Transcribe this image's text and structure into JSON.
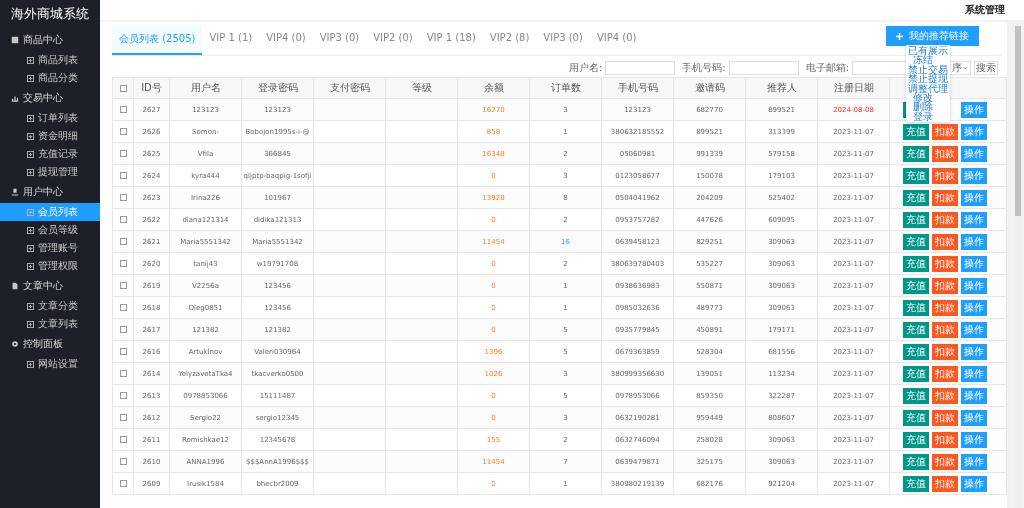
{
  "sidebar": {
    "title": "海外商城系统",
    "groups": [
      {
        "label": "商品中心",
        "children": [
          {
            "label": "商品列表",
            "selected": false
          },
          {
            "label": "商品分类",
            "selected": false
          }
        ]
      },
      {
        "label": "交易中心",
        "children": [
          {
            "label": "订单列表",
            "selected": false
          },
          {
            "label": "资金明细",
            "selected": false
          },
          {
            "label": "充值记录",
            "selected": false
          },
          {
            "label": "提现管理",
            "selected": false
          }
        ]
      },
      {
        "label": "用户中心",
        "children": [
          {
            "label": "会员列表",
            "selected": true
          },
          {
            "label": "会员等级",
            "selected": false
          },
          {
            "label": "管理账号",
            "selected": false
          },
          {
            "label": "管理权限",
            "selected": false
          }
        ]
      },
      {
        "label": "文章中心",
        "children": [
          {
            "label": "文章分类",
            "selected": false
          },
          {
            "label": "文章列表",
            "selected": false
          }
        ]
      },
      {
        "label": "控制面板",
        "children": [
          {
            "label": "网站设置",
            "selected": false
          }
        ]
      }
    ]
  },
  "header": {
    "title": "系统管理"
  },
  "tabs": [
    {
      "label": "会员列表 (2505)",
      "selected": true
    },
    {
      "label": "VIP 1 (1)",
      "selected": false
    },
    {
      "label": "VIP4 (0)",
      "selected": false
    },
    {
      "label": "VIP3 (0)",
      "selected": false
    },
    {
      "label": "VIP2 (0)",
      "selected": false
    },
    {
      "label": "VIP 1 (18)",
      "selected": false
    },
    {
      "label": "VIP2 (8)",
      "selected": false
    },
    {
      "label": "VIP3 (0)",
      "selected": false
    },
    {
      "label": "VIP4 (0)",
      "selected": false
    }
  ],
  "link_button": "我的推荐链接",
  "filters": {
    "fields": [
      {
        "label": "用户名:"
      },
      {
        "label": "手机号码:"
      },
      {
        "label": "电子邮箱:"
      }
    ],
    "select": "序",
    "search_button": "搜索"
  },
  "menu": [
    {
      "label": "已有展示",
      "children": [
        {
          "label": "冻结"
        }
      ]
    },
    {
      "label": "禁止交易"
    },
    {
      "label": "禁止提现"
    },
    {
      "label": "调整代理",
      "children": [
        {
          "label": "修改"
        },
        {
          "label": "删除"
        },
        {
          "label": "登录"
        }
      ]
    }
  ],
  "table": {
    "select_all_checked": false,
    "columns": [
      "ID号",
      "用户名",
      "登录密码",
      "支付密码",
      "等级",
      "余额",
      "订单数",
      "手机号码",
      "邀请码",
      "推荐人",
      "注册日期"
    ],
    "rows": [
      {
        "checked": false,
        "id": "2627",
        "user": "123123",
        "password": "123123",
        "balance": "16270",
        "orders": "3",
        "orders_linked": false,
        "phone": "123123",
        "invite": "682770",
        "referrer": "899521",
        "date": "2024-08-08",
        "date_alert": true,
        "actions": [
          {
            "kind": "recharge"
          },
          {
            "kind": "edit",
            "label": "操作"
          }
        ]
      },
      {
        "checked": false,
        "id": "2626",
        "user": "Somon-",
        "password": "Bobojon1995s-i-@",
        "balance": "858",
        "orders": "1",
        "orders_linked": false,
        "phone": "380632185552",
        "invite": "899521",
        "referrer": "313399",
        "date": "2023-11-07",
        "date_alert": false,
        "actions": [
          {
            "kind": "recharge",
            "label": "充值"
          },
          {
            "kind": "deduct",
            "label": "扣款"
          },
          {
            "kind": "edit",
            "label": "操作"
          }
        ]
      },
      {
        "checked": false,
        "id": "2625",
        "user": "Vfila",
        "password": "366845",
        "balance": "16348",
        "orders": "2",
        "orders_linked": false,
        "phone": "05060981",
        "invite": "991339",
        "referrer": "579158",
        "date": "2023-11-07",
        "date_alert": false,
        "actions": [
          {
            "kind": "recharge",
            "label": "充值"
          },
          {
            "kind": "deduct",
            "label": "扣款"
          },
          {
            "kind": "edit",
            "label": "操作"
          }
        ]
      },
      {
        "checked": false,
        "id": "2624",
        "user": "kyra444",
        "password": "qljptp-baqpig-1sofji",
        "balance": "0",
        "orders": "3",
        "orders_linked": false,
        "phone": "0123058677",
        "invite": "150078",
        "referrer": "179103",
        "date": "2023-11-07",
        "date_alert": false,
        "actions": [
          {
            "kind": "recharge",
            "label": "充值"
          },
          {
            "kind": "deduct",
            "label": "扣款"
          },
          {
            "kind": "edit",
            "label": "操作"
          }
        ]
      },
      {
        "checked": false,
        "id": "2623",
        "user": "Irina226",
        "password": "101967",
        "balance": "13920",
        "orders": "8",
        "orders_linked": false,
        "phone": "0504041962",
        "invite": "204209",
        "referrer": "525402",
        "date": "2023-11-07",
        "date_alert": false,
        "actions": [
          {
            "kind": "recharge",
            "label": "充值"
          },
          {
            "kind": "deduct",
            "label": "扣款"
          },
          {
            "kind": "edit",
            "label": "操作"
          }
        ]
      },
      {
        "checked": false,
        "id": "2622",
        "user": "diana121314",
        "password": "didika121313",
        "balance": "0",
        "orders": "2",
        "orders_linked": false,
        "phone": "0953757282",
        "invite": "447626",
        "referrer": "609095",
        "date": "2023-11-07",
        "date_alert": false,
        "actions": [
          {
            "kind": "recharge",
            "label": "充值"
          },
          {
            "kind": "deduct",
            "label": "扣款"
          },
          {
            "kind": "edit",
            "label": "操作"
          }
        ]
      },
      {
        "checked": false,
        "id": "2621",
        "user": "Maria5551342",
        "password": "Maria5551342",
        "balance": "11454",
        "orders": "16",
        "orders_linked": true,
        "phone": "0639458123",
        "invite": "829251",
        "referrer": "309063",
        "date": "2023-11-07",
        "date_alert": false,
        "actions": [
          {
            "kind": "recharge",
            "label": "充值"
          },
          {
            "kind": "deduct",
            "label": "扣款"
          },
          {
            "kind": "edit",
            "label": "操作"
          }
        ]
      },
      {
        "checked": false,
        "id": "2620",
        "user": "tanij43",
        "password": "w19791708",
        "balance": "0",
        "orders": "2",
        "orders_linked": false,
        "phone": "380639780403",
        "invite": "535227",
        "referrer": "309063",
        "date": "2023-11-07",
        "date_alert": false,
        "actions": [
          {
            "kind": "recharge",
            "label": "充值"
          },
          {
            "kind": "deduct",
            "label": "扣款"
          },
          {
            "kind": "edit",
            "label": "操作"
          }
        ]
      },
      {
        "checked": false,
        "id": "2619",
        "user": "V2256a",
        "password": "123456",
        "balance": "0",
        "orders": "1",
        "orders_linked": false,
        "phone": "0938636983",
        "invite": "550871",
        "referrer": "309063",
        "date": "2023-11-07",
        "date_alert": false,
        "actions": [
          {
            "kind": "recharge",
            "label": "充值"
          },
          {
            "kind": "deduct",
            "label": "扣款"
          },
          {
            "kind": "edit",
            "label": "操作"
          }
        ]
      },
      {
        "checked": false,
        "id": "2618",
        "user": "Oleg0851",
        "password": "123456",
        "balance": "0",
        "orders": "1",
        "orders_linked": false,
        "phone": "0985032636",
        "invite": "489773",
        "referrer": "309063",
        "date": "2023-11-07",
        "date_alert": false,
        "actions": [
          {
            "kind": "recharge",
            "label": "充值"
          },
          {
            "kind": "deduct",
            "label": "扣款"
          },
          {
            "kind": "edit",
            "label": "操作"
          }
        ]
      },
      {
        "checked": false,
        "id": "2617",
        "user": "121382",
        "password": "121382",
        "balance": "0",
        "orders": "5",
        "orders_linked": false,
        "phone": "0935779845",
        "invite": "450891",
        "referrer": "179171",
        "date": "2023-11-07",
        "date_alert": false,
        "actions": [
          {
            "kind": "recharge",
            "label": "充值"
          },
          {
            "kind": "deduct",
            "label": "扣款"
          },
          {
            "kind": "edit",
            "label": "操作"
          }
        ]
      },
      {
        "checked": false,
        "id": "2616",
        "user": "Artuklnov",
        "password": "Valeri030964",
        "balance": "1396",
        "orders": "5",
        "orders_linked": false,
        "phone": "0679363859",
        "invite": "528304",
        "referrer": "681556",
        "date": "2023-11-07",
        "date_alert": false,
        "actions": [
          {
            "kind": "recharge",
            "label": "充值"
          },
          {
            "kind": "deduct",
            "label": "扣款"
          },
          {
            "kind": "edit",
            "label": "操作"
          }
        ]
      },
      {
        "checked": false,
        "id": "2614",
        "user": "YelyzavetaTka4",
        "password": "tkacverko0500",
        "balance": "1026",
        "orders": "3",
        "orders_linked": false,
        "phone": "380999356630",
        "invite": "139051",
        "referrer": "113234",
        "date": "2023-11-07",
        "date_alert": false,
        "actions": [
          {
            "kind": "recharge",
            "label": "充值"
          },
          {
            "kind": "deduct",
            "label": "扣款"
          },
          {
            "kind": "edit",
            "label": "操作"
          }
        ]
      },
      {
        "checked": false,
        "id": "2613",
        "user": "0978853066",
        "password": "15111487",
        "balance": "0",
        "orders": "5",
        "orders_linked": false,
        "phone": "0978953066",
        "invite": "859350",
        "referrer": "322287",
        "date": "2023-11-07",
        "date_alert": false,
        "actions": [
          {
            "kind": "recharge",
            "label": "充值"
          },
          {
            "kind": "deduct",
            "label": "扣款"
          },
          {
            "kind": "edit",
            "label": "操作"
          }
        ]
      },
      {
        "checked": false,
        "id": "2612",
        "user": "Sergio22",
        "password": "sergio12345",
        "balance": "0",
        "orders": "3",
        "orders_linked": false,
        "phone": "0632190281",
        "invite": "959449",
        "referrer": "808607",
        "date": "2023-11-07",
        "date_alert": false,
        "actions": [
          {
            "kind": "recharge",
            "label": "充值"
          },
          {
            "kind": "deduct",
            "label": "扣款"
          },
          {
            "kind": "edit",
            "label": "操作"
          }
        ]
      },
      {
        "checked": false,
        "id": "2611",
        "user": "Romishkae12",
        "password": "12345678",
        "balance": "155",
        "orders": "2",
        "orders_linked": false,
        "phone": "0632746094",
        "invite": "258028",
        "referrer": "309063",
        "date": "2023-11-07",
        "date_alert": false,
        "actions": [
          {
            "kind": "recharge",
            "label": "充值"
          },
          {
            "kind": "deduct",
            "label": "扣款"
          },
          {
            "kind": "edit",
            "label": "操作"
          }
        ]
      },
      {
        "checked": false,
        "id": "2610",
        "user": "ANNA1996",
        "password": "$$$AnnA1996$$$",
        "balance": "11454",
        "orders": "7",
        "orders_linked": false,
        "phone": "0639479871",
        "invite": "325175",
        "referrer": "309063",
        "date": "2023-11-07",
        "date_alert": false,
        "actions": [
          {
            "kind": "recharge",
            "label": "充值"
          },
          {
            "kind": "deduct",
            "label": "扣款"
          },
          {
            "kind": "edit",
            "label": "操作"
          }
        ]
      },
      {
        "checked": false,
        "id": "2609",
        "user": "Irusik1584",
        "password": "bhecbr2009",
        "balance": "0",
        "orders": "1",
        "orders_linked": false,
        "phone": "380980219139",
        "invite": "682176",
        "referrer": "921204",
        "date": "2023-11-07",
        "date_alert": false,
        "actions": [
          {
            "kind": "recharge",
            "label": "充值"
          },
          {
            "kind": "deduct",
            "label": "扣款"
          },
          {
            "kind": "edit",
            "label": "操作"
          }
        ]
      }
    ]
  }
}
